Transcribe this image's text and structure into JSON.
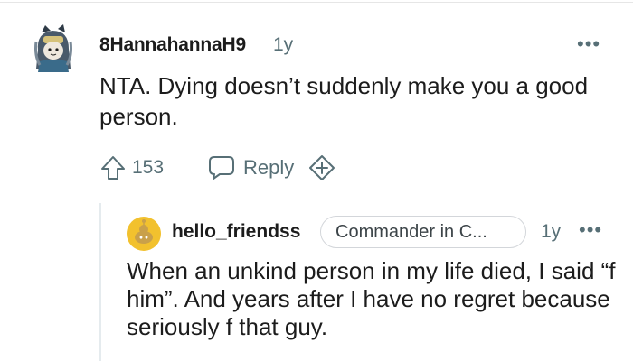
{
  "comment": {
    "author": "8HannahannaH9",
    "age": "1y",
    "more_label": "•••",
    "body": "NTA. Dying doesn’t suddenly make you a good person.",
    "vote_count": "153",
    "reply_label": "Reply",
    "icons": [
      "avatar",
      "upvote-icon",
      "reply-bubble-icon",
      "award-plus-icon"
    ]
  },
  "reply": {
    "author": "hello_friendss",
    "flair": "Commander in C...",
    "age": "1y",
    "more_label": "•••",
    "body": "When an unkind person in my life died, I said “f him”. And years after I have no regret because seriously f that guy."
  },
  "colors": {
    "text": "#1c1c1c",
    "meta": "#576f76",
    "flair_border": "#d3d6da",
    "thread_line": "#e5ebee",
    "reply_avatar": "#f2c12e"
  }
}
